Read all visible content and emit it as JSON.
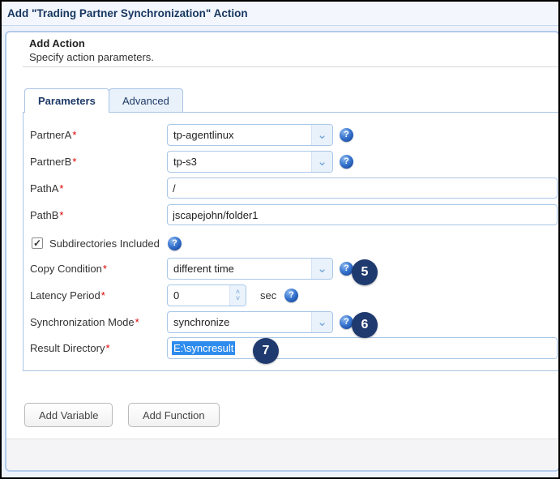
{
  "window": {
    "title": "Add \"Trading Partner Synchronization\" Action"
  },
  "header": {
    "title": "Add Action",
    "subtitle": "Specify action parameters."
  },
  "required_mark": "*",
  "tabs": [
    {
      "label": "Parameters",
      "active": true
    },
    {
      "label": "Advanced",
      "active": false
    }
  ],
  "form": {
    "partner_a": {
      "label": "PartnerA",
      "value": "tp-agentlinux"
    },
    "partner_b": {
      "label": "PartnerB",
      "value": "tp-s3"
    },
    "path_a": {
      "label": "PathA",
      "value": "/"
    },
    "path_b": {
      "label": "PathB",
      "value": "jscapejohn/folder1"
    },
    "subdirectories": {
      "label": "Subdirectories Included",
      "checked": "true"
    },
    "copy_condition": {
      "label": "Copy Condition",
      "value": "different time",
      "badge": "5"
    },
    "latency_period": {
      "label": "Latency Period",
      "value": "0",
      "unit": "sec"
    },
    "sync_mode": {
      "label": "Synchronization Mode",
      "value": "synchronize",
      "badge": "6"
    },
    "result_directory": {
      "label": "Result Directory",
      "value": "E:\\syncresult",
      "badge": "7"
    }
  },
  "buttons": {
    "add_variable": "Add Variable",
    "add_function": "Add Function"
  },
  "icons": {
    "help_glyph": "?",
    "dropdown_glyph": "⌄",
    "spin_up_glyph": "˄",
    "spin_down_glyph": "˅",
    "checkmark_glyph": "✓"
  },
  "colors": {
    "title_navy": "#16355f",
    "field_border_blue": "#a9c7e8",
    "panel_border_blue": "#b3cbea",
    "badge_navy": "#1f3a6e",
    "help_blue": "#1c4fa8",
    "selection_blue": "#2e8ced",
    "required_red": "#dd0000"
  }
}
